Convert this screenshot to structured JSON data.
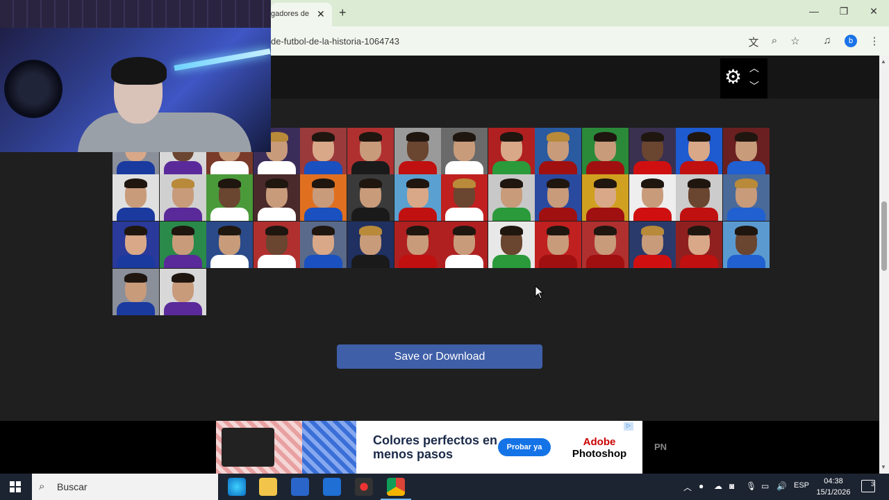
{
  "browser": {
    "tab_title": "gadores de",
    "tab_close": "✕",
    "new_tab": "+",
    "url": "de-futbol-de-la-historia-1064743",
    "profile_letter": "b",
    "window_controls": {
      "minimize": "—",
      "restore": "❐",
      "close": "✕"
    },
    "toolbar_icons": [
      "translate-icon",
      "zoom-icon",
      "bookmark-star-icon",
      "media-icon",
      "menu-icon"
    ]
  },
  "page": {
    "save_button": "Save or Download",
    "settings_icon": "gear-icon",
    "grid_rows": 4,
    "players_count": 48
  },
  "ad": {
    "headline": "Colores perfectos en menos pasos",
    "cta": "Probar ya",
    "brand_line1": "Adobe",
    "brand_line2": "Photoshop",
    "adchoice": "▷",
    "side_label": "PN"
  },
  "taskbar": {
    "search_placeholder": "Buscar",
    "language": "ESP",
    "time": "04:38",
    "date": "15/1/2026",
    "notifications": "3"
  },
  "colors": {
    "save_button": "#3f5fa8",
    "page_bg": "#1f1f1f",
    "ad_cta": "#1473e6",
    "taskbar": "#1c2431"
  }
}
